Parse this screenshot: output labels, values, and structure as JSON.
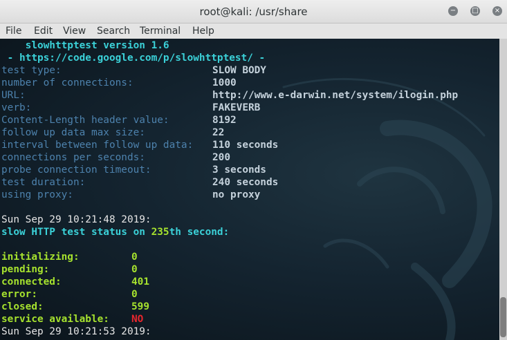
{
  "window": {
    "title": "root@kali: /usr/share",
    "minimize_glyph": "−",
    "maximize_glyph": "□",
    "close_glyph": "×"
  },
  "menu": [
    "File",
    "Edit",
    "View",
    "Search",
    "Terminal",
    "Help"
  ],
  "terminal": {
    "banner_version": "    slowhttptest version 1.6",
    "banner_url": " - https://code.google.com/p/slowhttptest/ -",
    "config": [
      {
        "label": "test type:",
        "value": "SLOW BODY"
      },
      {
        "label": "number of connections:",
        "value": "1000"
      },
      {
        "label": "URL:",
        "value": "http://www.e-darwin.net/system/ilogin.php"
      },
      {
        "label": "verb:",
        "value": "FAKEVERB"
      },
      {
        "label": "Content-Length header value:",
        "value": "8192"
      },
      {
        "label": "follow up data max size:",
        "value": "22"
      },
      {
        "label": "interval between follow up data:",
        "value": "110 seconds"
      },
      {
        "label": "connections per seconds:",
        "value": "200"
      },
      {
        "label": "probe connection timeout:",
        "value": "3 seconds"
      },
      {
        "label": "test duration:",
        "value": "240 seconds"
      },
      {
        "label": "using proxy:",
        "value": "no proxy"
      }
    ],
    "timestamp_1": "Sun Sep 29 10:21:48 2019:",
    "status_prefix": "slow HTTP test status on ",
    "status_second": "235",
    "status_suffix": "th second:",
    "stats": [
      {
        "label": "initializing:",
        "value": "0"
      },
      {
        "label": "pending:",
        "value": "0"
      },
      {
        "label": "connected:",
        "value": "401"
      },
      {
        "label": "error:",
        "value": "0"
      },
      {
        "label": "closed:",
        "value": "599"
      },
      {
        "label": "service available:",
        "value": "NO",
        "status_color": "#e8262d"
      }
    ],
    "timestamp_2": "Sun Sep 29 10:21:53 2019:"
  },
  "colors": {
    "banner": "#3bd1d8",
    "config_label": "#4d82ad",
    "stats": "#a6e22e",
    "alert": "#e8262d"
  }
}
